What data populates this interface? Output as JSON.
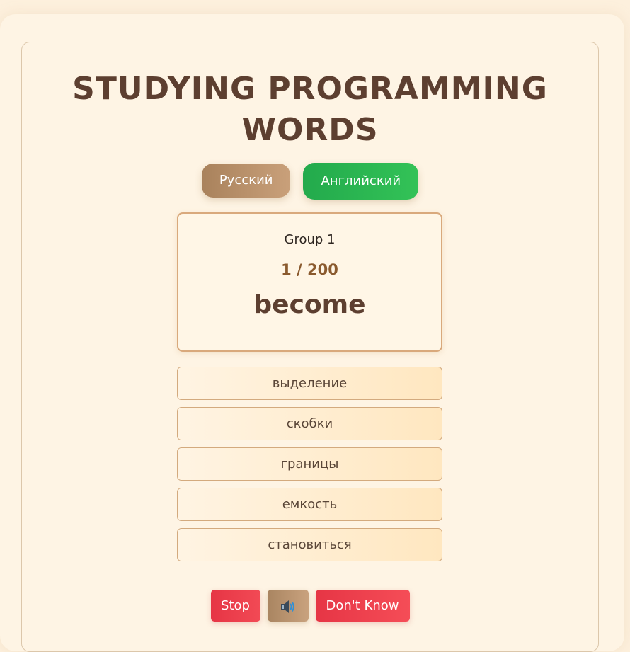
{
  "title": "STUDYING PROGRAMMING WORDS",
  "language_buttons": {
    "russian": "Русский",
    "english": "Английский",
    "active": "english"
  },
  "word_card": {
    "group": "Group 1",
    "progress": "1 / 200",
    "word": "become"
  },
  "options": [
    "выделение",
    "скобки",
    "границы",
    "емкость",
    "становиться"
  ],
  "controls": {
    "stop": "Stop",
    "sound_icon": "speaker-icon",
    "dont_know": "Don't Know"
  },
  "colors": {
    "title": "#5d3f30",
    "active_language": "#2bb552",
    "danger": "#ec404e",
    "accent_brown": "#b9926c"
  }
}
